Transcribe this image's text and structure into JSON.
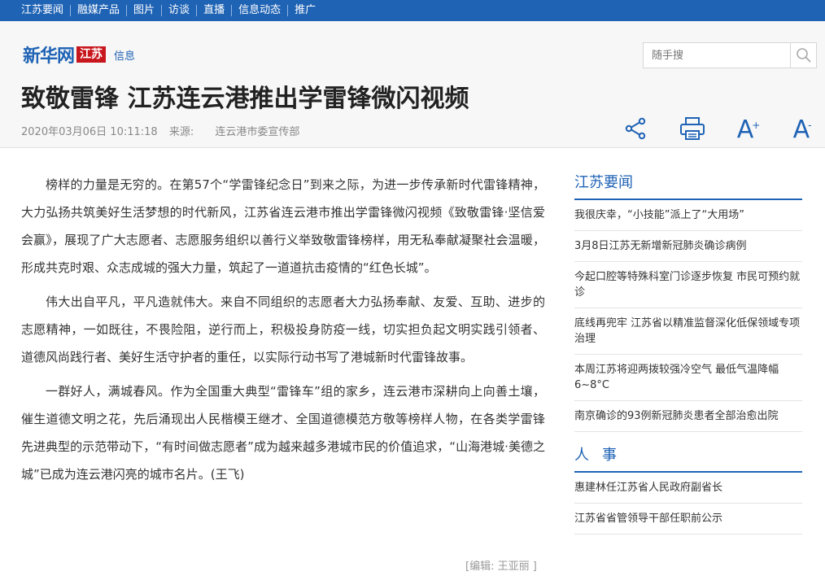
{
  "topnav": {
    "items": [
      "江苏要闻",
      "融媒产品",
      "图片",
      "访谈",
      "直播",
      "信息动态",
      "推广"
    ]
  },
  "logo": {
    "brand": "新华网",
    "region": "江苏",
    "section": "信息"
  },
  "search": {
    "placeholder": "随手搜",
    "icon": "search-icon"
  },
  "article": {
    "title": "致敬雷锋 江苏连云港推出学雷锋微闪视频",
    "datetime": "2020年03月06日 10:11:18",
    "source_label": "来源:",
    "source": "连云港市委宣传部",
    "paragraphs": [
      "榜样的力量是无穷的。在第57个“学雷锋纪念日”到来之际，为进一步传承新时代雷锋精神，大力弘扬共筑美好生活梦想的时代新风，江苏省连云港市推出学雷锋微闪视频《致敬雷锋·坚信爱会赢》，展现了广大志愿者、志愿服务组织以善行义举致敬雷锋榜样，用无私奉献凝聚社会温暖，形成共克时艰、众志成城的强大力量，筑起了一道道抗击疫情的“红色长城”。",
      "伟大出自平凡，平凡造就伟大。来自不同组织的志愿者大力弘扬奉献、友爱、互助、进步的志愿精神，一如既往，不畏险阻，逆行而上，积极投身防疫一线，切实担负起文明实践引领者、道德风尚践行者、美好生活守护者的重任，以实际行动书写了港城新时代雷锋故事。",
      "一群好人，满城春风。作为全国重大典型“雷锋车”组的家乡，连云港市深耕向上向善土壤，催生道德文明之花，先后涌现出人民楷模王继才、全国道德模范方敬等榜样人物，在各类学雷锋先进典型的示范带动下，“有时间做志愿者”成为越来越多港城市民的价值追求，“山海港城·美德之城”已成为连云港闪亮的城市名片。(王飞)"
    ],
    "editor": "[编辑: 王亚丽 ]"
  },
  "tools": {
    "share_icon": "share-icon",
    "print_icon": "print-icon",
    "font_increase": "A",
    "font_increase_sup": "+",
    "font_decrease": "A",
    "font_decrease_sup": "-"
  },
  "sidebar": {
    "section1_title": "江苏要闻",
    "section1_items": [
      "我很庆幸，“小技能”派上了“大用场”",
      "3月8日江苏无新增新冠肺炎确诊病例",
      "今起口腔等特殊科室门诊逐步恢复 市民可预约就诊",
      "底线再兜牢 江苏省以精准监督深化低保领域专项治理",
      "本周江苏将迎两拨较强冷空气 最低气温降幅6~8°C",
      "南京确诊的93例新冠肺炎患者全部治愈出院"
    ],
    "section2_title": "人事",
    "section2_items": [
      "惠建林任江苏省人民政府副省长",
      "江苏省省管领导干部任职前公示"
    ]
  },
  "colors": {
    "brand_blue": "#1f63b5",
    "brand_red": "#c8161d"
  }
}
